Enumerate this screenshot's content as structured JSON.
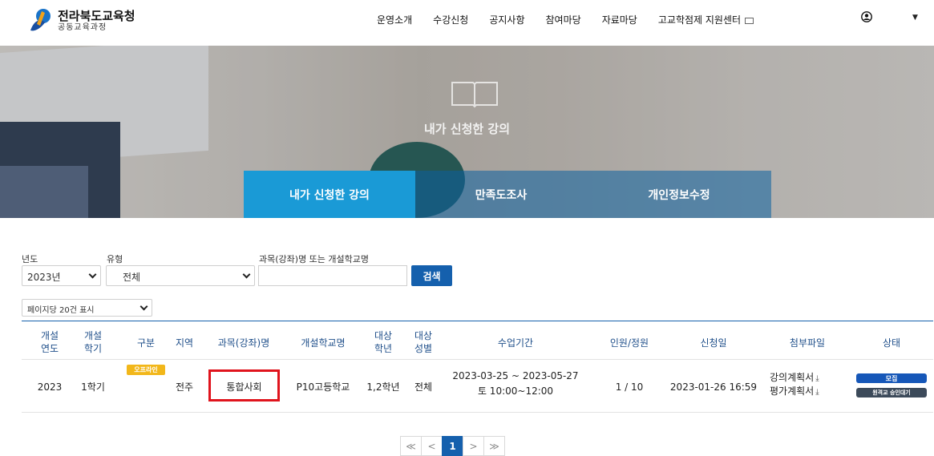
{
  "header": {
    "logo_title": "전라북도교육청",
    "logo_sub": "공동교육과정",
    "nav": [
      "운영소개",
      "수강신청",
      "공지사항",
      "참여마당",
      "자료마당",
      "고교학점제 지원센터"
    ]
  },
  "hero": {
    "title": "내가 신청한 강의",
    "tabs": [
      "내가 신청한 강의",
      "만족도조사",
      "개인정보수정"
    ]
  },
  "filters": {
    "year_label": "년도",
    "type_label": "유형",
    "subject_label": "과목(강좌)명 또는 개설학교명",
    "year_value": "2023년",
    "type_value": "전체",
    "subject_value": "",
    "search_button": "검색",
    "per_page": "페이지당 20건 표시"
  },
  "table": {
    "headers": {
      "open_year": [
        "개설",
        "연도"
      ],
      "open_term": [
        "개설",
        "학기"
      ],
      "category": "구분",
      "region": "지역",
      "subject": "과목(강좌)명",
      "school": "개설학교명",
      "grade": [
        "대상",
        "학년"
      ],
      "gender": [
        "대상",
        "성별"
      ],
      "period": "수업기간",
      "capacity": "인원/정원",
      "applied": "신청일",
      "files": "첨부파일",
      "status": "상태"
    },
    "row": {
      "year": "2023",
      "term": "1학기",
      "category_badge": "오프라인",
      "region": "전주",
      "subject": "통합사회",
      "school": "P10고등학교",
      "grade": "1,2학년",
      "gender": "전체",
      "period_line1": "2023-03-25 ~ 2023-05-27",
      "period_line2": "토 10:00~12:00",
      "capacity": "1 / 10",
      "applied": "2023-01-26 16:59",
      "file1": "강의계획서",
      "file2": "평가계획서",
      "status1": "모집",
      "status2": "원격교 승인대기"
    }
  },
  "pagination": {
    "first": "≪",
    "prev": "<",
    "current": "1",
    "next": ">",
    "last": "≫"
  },
  "colors": {
    "primary": "#1560ad",
    "tab_active": "#1a9ad6",
    "badge_offline": "#f2b71a",
    "highlight": "#e0141d"
  }
}
